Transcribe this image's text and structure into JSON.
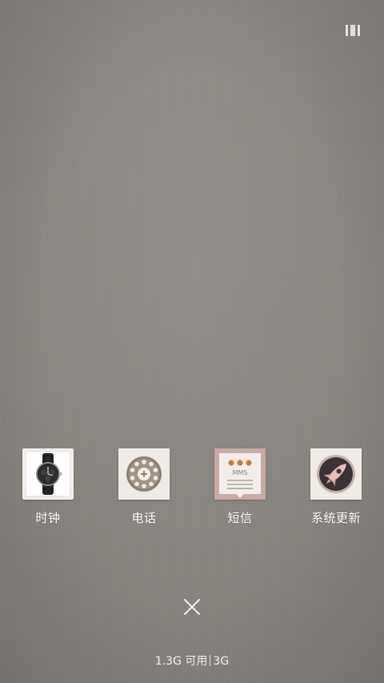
{
  "apps": [
    {
      "label": "时钟",
      "icon": "watch-icon"
    },
    {
      "label": "电话",
      "icon": "rotary-phone-icon"
    },
    {
      "label": "短信",
      "icon": "mms-icon",
      "icon_text": "MMS"
    },
    {
      "label": "系统更新",
      "icon": "rocket-icon"
    }
  ],
  "status": {
    "available": "1.3G 可用",
    "network": "3G"
  },
  "icons": {
    "top_right": "screen-toggle-icon",
    "close": "close-icon"
  },
  "colors": {
    "background": "#8a8682",
    "label": "#ffffff",
    "mms_tile": "#c9aaa4",
    "mms_dot": "#c97a3b"
  }
}
